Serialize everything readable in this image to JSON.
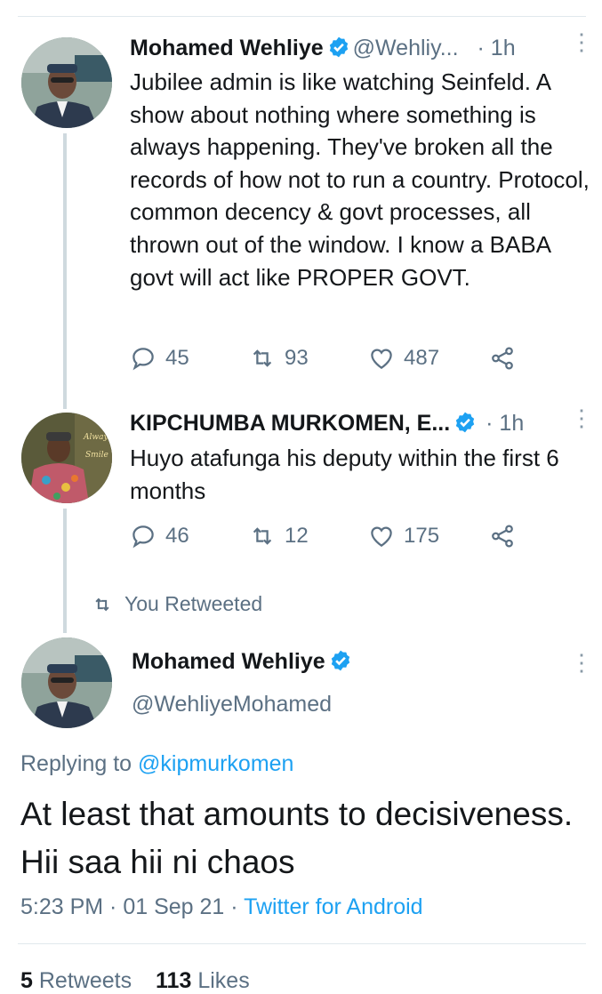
{
  "tweet1": {
    "name": "Mohamed Wehliye",
    "handle": "@Wehliy...",
    "time": "· 1h",
    "text": "Jubilee admin is like watching Seinfeld. A show about nothing where something is always happening. They've broken all the records of how not to run a country. Protocol, common decency & govt processes, all thrown out of the window. I know a BABA govt will act like PROPER GOVT.",
    "replies": "45",
    "retweets": "93",
    "likes": "487"
  },
  "tweet2": {
    "name": "KIPCHUMBA MURKOMEN, E...",
    "time": "· 1h",
    "text": "Huyo atafunga his deputy within the first 6 months",
    "replies": "46",
    "retweets": "12",
    "likes": "175"
  },
  "retweet_note": "You Retweeted",
  "focus": {
    "name": "Mohamed Wehliye",
    "handle": "@WehliyeMohamed",
    "replying_prefix": "Replying to",
    "replying_to": "@kipmurkomen",
    "text": "At least that amounts to decisiveness. Hii saa hii ni chaos",
    "time": "5:23 PM · 01 Sep 21 ·",
    "source": "Twitter for Android",
    "retweets_count": "5",
    "retweets_label": "Retweets",
    "likes_count": "113",
    "likes_label": "Likes"
  },
  "colors": {
    "accent": "#1da1f2",
    "muted": "#5b7083",
    "text": "#14171a"
  }
}
